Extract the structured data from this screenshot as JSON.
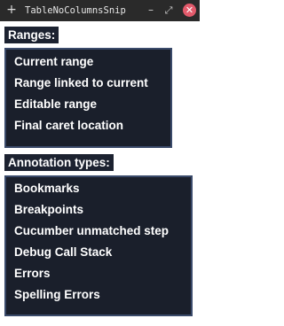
{
  "window": {
    "title": "TableNoColumnsSnip",
    "pin_glyph": "+",
    "minimize_glyph": "–",
    "maximize_glyph": "⤢",
    "close_glyph": "✕"
  },
  "ranges": {
    "heading": "Ranges:",
    "items": [
      {
        "label": "Current range"
      },
      {
        "label": "Range linked to current"
      },
      {
        "label": "Editable range"
      },
      {
        "label": "Final caret location"
      }
    ]
  },
  "annotations": {
    "heading": "Annotation types:",
    "items": [
      {
        "label": "Bookmarks"
      },
      {
        "label": "Breakpoints"
      },
      {
        "label": "Cucumber unmatched step"
      },
      {
        "label": "Debug Call Stack"
      },
      {
        "label": "Errors"
      },
      {
        "label": "Spelling Errors"
      }
    ]
  },
  "colors": {
    "titlebar_bg": "#2a2a2a",
    "close_button": "#e25a6b",
    "panel_bg": "#1a1f2b",
    "panel_border": "#3a4a6a"
  }
}
